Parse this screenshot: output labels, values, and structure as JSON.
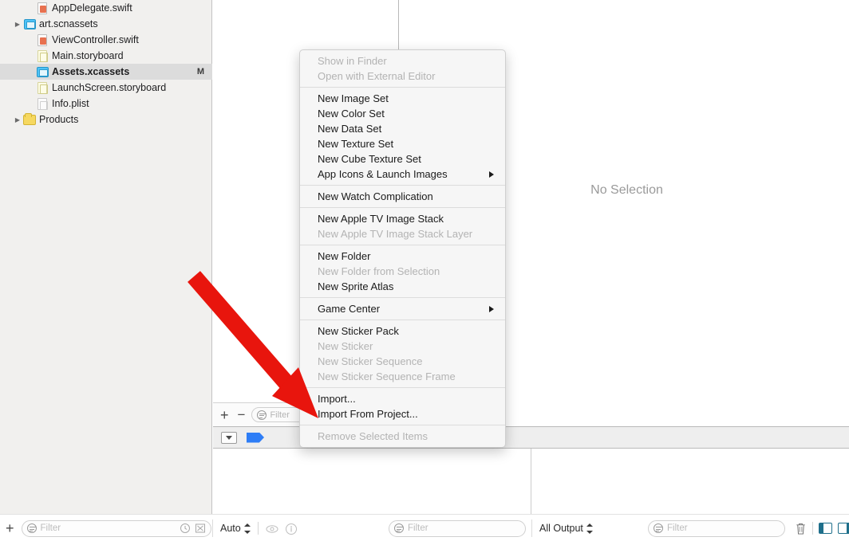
{
  "navigator": {
    "files": [
      {
        "label": "AppDelegate.swift",
        "icon": "swift-file-icon",
        "indent": 1,
        "twisty": false,
        "selected": false,
        "status": ""
      },
      {
        "label": "art.scnassets",
        "icon": "xcassets-file-icon",
        "indent": 0,
        "twisty": true,
        "selected": false,
        "status": ""
      },
      {
        "label": "ViewController.swift",
        "icon": "swift-file-icon",
        "indent": 1,
        "twisty": false,
        "selected": false,
        "status": ""
      },
      {
        "label": "Main.storyboard",
        "icon": "storyboard-file-icon",
        "indent": 1,
        "twisty": false,
        "selected": false,
        "status": ""
      },
      {
        "label": "Assets.xcassets",
        "icon": "xcassets-file-icon",
        "indent": 1,
        "twisty": false,
        "selected": true,
        "status": "M"
      },
      {
        "label": "LaunchScreen.storyboard",
        "icon": "storyboard-file-icon",
        "indent": 1,
        "twisty": false,
        "selected": false,
        "status": ""
      },
      {
        "label": "Info.plist",
        "icon": "plist-file-icon",
        "indent": 1,
        "twisty": false,
        "selected": false,
        "status": ""
      },
      {
        "label": "Products",
        "icon": "folder-icon",
        "indent": 0,
        "twisty": true,
        "selected": false,
        "status": ""
      }
    ],
    "filter_placeholder": "Filter",
    "add_label": "+"
  },
  "editor": {
    "no_selection_text": "No Selection"
  },
  "asset_pane": {
    "add_label": "+",
    "remove_label": "−",
    "filter_placeholder": "Filter"
  },
  "context_menu": {
    "groups": [
      [
        {
          "label": "Show in Finder",
          "disabled": true,
          "submenu": false
        },
        {
          "label": "Open with External Editor",
          "disabled": true,
          "submenu": false
        }
      ],
      [
        {
          "label": "New Image Set",
          "disabled": false,
          "submenu": false
        },
        {
          "label": "New Color Set",
          "disabled": false,
          "submenu": false
        },
        {
          "label": "New Data Set",
          "disabled": false,
          "submenu": false
        },
        {
          "label": "New Texture Set",
          "disabled": false,
          "submenu": false
        },
        {
          "label": "New Cube Texture Set",
          "disabled": false,
          "submenu": false
        },
        {
          "label": "App Icons & Launch Images",
          "disabled": false,
          "submenu": true
        }
      ],
      [
        {
          "label": "New Watch Complication",
          "disabled": false,
          "submenu": false
        }
      ],
      [
        {
          "label": "New Apple TV Image Stack",
          "disabled": false,
          "submenu": false
        },
        {
          "label": "New Apple TV Image Stack Layer",
          "disabled": true,
          "submenu": false
        }
      ],
      [
        {
          "label": "New Folder",
          "disabled": false,
          "submenu": false
        },
        {
          "label": "New Folder from Selection",
          "disabled": true,
          "submenu": false
        },
        {
          "label": "New Sprite Atlas",
          "disabled": false,
          "submenu": false
        }
      ],
      [
        {
          "label": "Game Center",
          "disabled": false,
          "submenu": true
        }
      ],
      [
        {
          "label": "New Sticker Pack",
          "disabled": false,
          "submenu": false
        },
        {
          "label": "New Sticker",
          "disabled": true,
          "submenu": false
        },
        {
          "label": "New Sticker Sequence",
          "disabled": true,
          "submenu": false
        },
        {
          "label": "New Sticker Sequence Frame",
          "disabled": true,
          "submenu": false
        }
      ],
      [
        {
          "label": "Import...",
          "disabled": false,
          "submenu": false
        },
        {
          "label": "Import From Project...",
          "disabled": false,
          "submenu": false
        }
      ],
      [
        {
          "label": "Remove Selected Items",
          "disabled": true,
          "submenu": false
        }
      ]
    ]
  },
  "bottom_bar": {
    "add_label": "+",
    "left_filter_placeholder": "Filter",
    "auto_label": "Auto",
    "console_filter_placeholder": "Filter",
    "output_label": "All Output",
    "right_filter_placeholder": "Filter"
  },
  "annotation": {
    "arrow_color": "#e8150d"
  }
}
